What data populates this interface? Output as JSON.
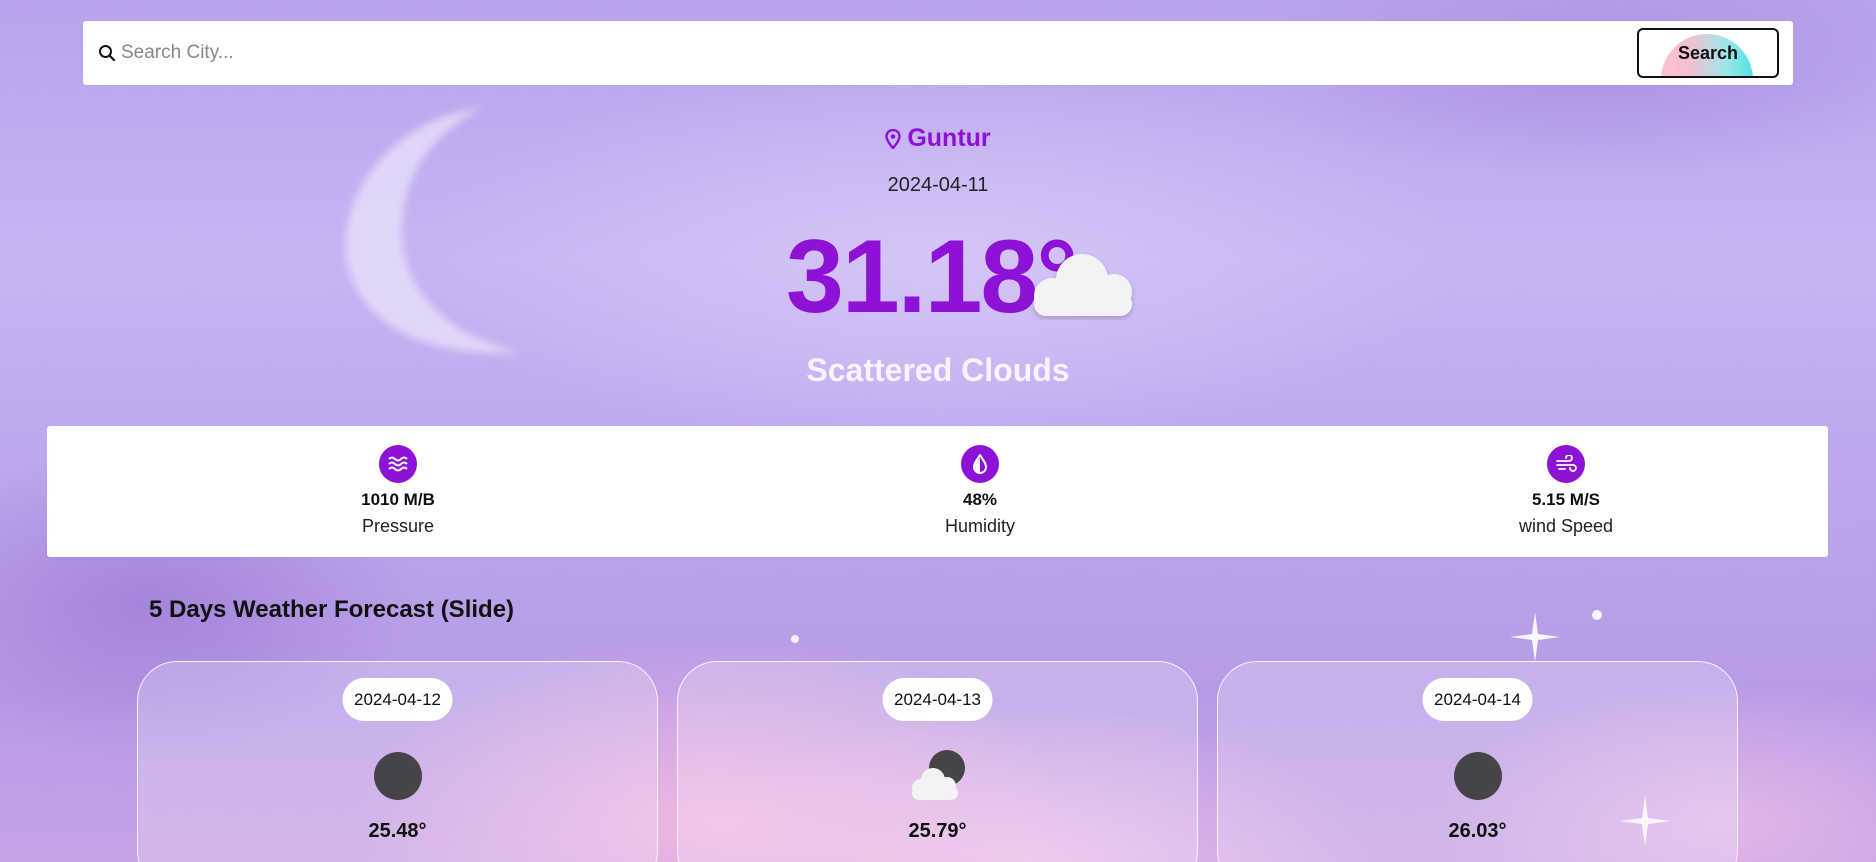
{
  "search": {
    "placeholder": "Search City...",
    "button_label": "Search"
  },
  "current": {
    "city": "Guntur",
    "date": "2024-04-11",
    "temperature": "31.18°",
    "condition": "Scattered Clouds",
    "icon": "cloud-icon"
  },
  "stats": [
    {
      "value": "1010 M/B",
      "label": "Pressure",
      "icon": "waves-icon"
    },
    {
      "value": "48%",
      "label": "Humidity",
      "icon": "water-drop-icon"
    },
    {
      "value": "5.15 M/S",
      "label": "wind Speed",
      "icon": "wind-icon"
    }
  ],
  "forecast": {
    "title": "5 Days Weather Forecast (Slide)",
    "days": [
      {
        "date": "2024-04-12",
        "temp": "25.48°",
        "icon": "clear-night-icon"
      },
      {
        "date": "2024-04-13",
        "temp": "25.79°",
        "icon": "cloudy-night-icon"
      },
      {
        "date": "2024-04-14",
        "temp": "26.03°",
        "icon": "clear-night-icon"
      }
    ]
  },
  "colors": {
    "accent": "#8d12d6",
    "panel": "#ffffff"
  }
}
